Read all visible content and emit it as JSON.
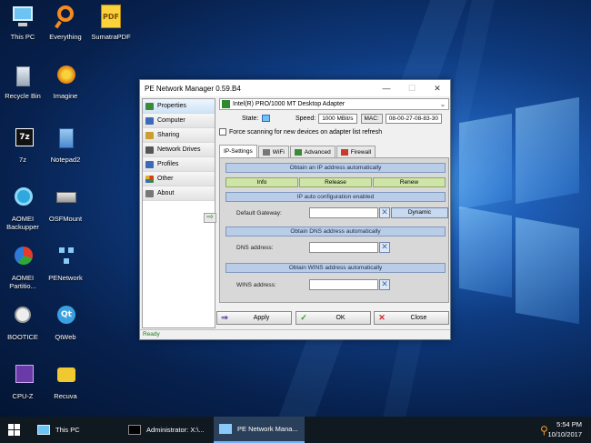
{
  "desktop": {
    "icons": [
      {
        "label": "This PC"
      },
      {
        "label": "Everything"
      },
      {
        "label": "SumatraPDF"
      },
      {
        "label": "Recycle Bin"
      },
      {
        "label": "Imagine"
      },
      {
        "label": "7z"
      },
      {
        "label": "Notepad2"
      },
      {
        "label": "AOMEI Backupper"
      },
      {
        "label": "OSFMount"
      },
      {
        "label": "AOMEI Partitio..."
      },
      {
        "label": "PENetwork"
      },
      {
        "label": "BOOTICE"
      },
      {
        "label": "QtWeb"
      },
      {
        "label": "CPU-Z"
      },
      {
        "label": "Recuva"
      }
    ]
  },
  "window": {
    "title": "PE Network Manager 0.59.B4",
    "controls": {
      "minimize": "—",
      "maximize": "☐",
      "close": "✕"
    },
    "sidebar": [
      {
        "label": "Properties",
        "icon": "properties-icon",
        "color": "#3a8a3a"
      },
      {
        "label": "Computer",
        "icon": "computer-icon",
        "color": "#3a6ab8"
      },
      {
        "label": "Sharing",
        "icon": "sharing-icon",
        "color": "#c8a030"
      },
      {
        "label": "Network Drives",
        "icon": "network-drives-icon",
        "color": "#555555"
      },
      {
        "label": "Profiles",
        "icon": "profiles-icon",
        "color": "#3a6ab8"
      },
      {
        "label": "Other",
        "icon": "other-icon",
        "color": "#d04020"
      },
      {
        "label": "About",
        "icon": "about-icon",
        "color": "#555555"
      }
    ],
    "adapter": "Intel(R) PRO/1000 MT Desktop Adapter",
    "state_label": "State:",
    "speed_label": "Speed:",
    "speed_value": "1000 MBit/s",
    "mac_label": "MAC:",
    "mac_value": "08-00-27-08-83-30",
    "force_scan_label": "Force scanning for new devices on adapter list refresh",
    "tabs": [
      {
        "label": "IP-Settings",
        "icon": ""
      },
      {
        "label": "WiFi",
        "icon": "wifi-icon"
      },
      {
        "label": "Advanced",
        "icon": "advanced-icon"
      },
      {
        "label": "Firewall",
        "icon": "firewall-icon"
      }
    ],
    "ip_section": "Obtain an IP address automatically",
    "ip_buttons": [
      "Info",
      "Release",
      "Renew"
    ],
    "auto_config": "IP auto configuration enabled",
    "gateway_label": "Default Gateway:",
    "dynamic_label": "Dynamic",
    "dns_section": "Obtain DNS address automatically",
    "dns_label": "DNS address:",
    "wins_section": "Obtain WINS address automatically",
    "wins_label": "WINS address:",
    "buttons": {
      "apply": "Apply",
      "ok": "OK",
      "close": "Close"
    },
    "status": "Ready"
  },
  "taskbar": {
    "items": [
      {
        "label": "This PC"
      },
      {
        "label": "Administrator: X:\\..."
      },
      {
        "label": "PE Network Mana..."
      }
    ],
    "time": "5:54 PM",
    "date": "10/10/2017"
  }
}
